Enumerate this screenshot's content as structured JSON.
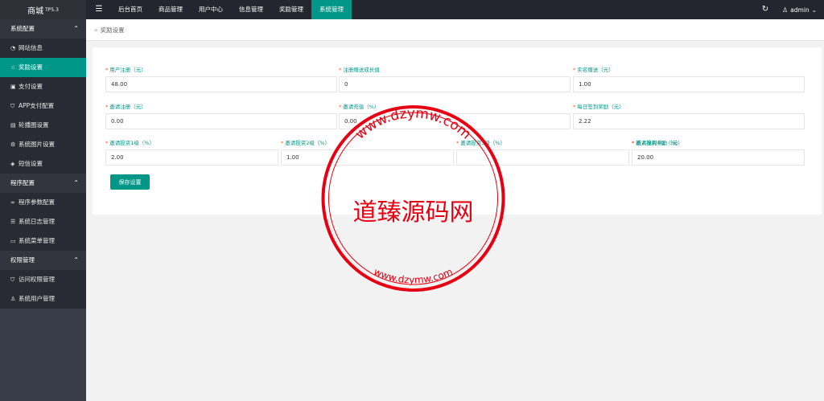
{
  "app": {
    "title": "商城",
    "version": "TP5.3"
  },
  "topnav": {
    "items": [
      {
        "label": "后台首页",
        "active": false
      },
      {
        "label": "商品管理",
        "active": false
      },
      {
        "label": "用户中心",
        "active": false
      },
      {
        "label": "信息管理",
        "active": false
      },
      {
        "label": "奖励管理",
        "active": false
      },
      {
        "label": "系统管理",
        "active": true
      }
    ],
    "user": "admin"
  },
  "sidebar": {
    "groups": [
      {
        "label": "系统配置",
        "items": [
          {
            "label": "网站信息",
            "icon": "dashboard-icon"
          },
          {
            "label": "奖励设置",
            "icon": "star-icon",
            "active": true
          },
          {
            "label": "支付设置",
            "icon": "money-icon"
          },
          {
            "label": "APP支付配置",
            "icon": "shield-icon"
          },
          {
            "label": "轮播图设置",
            "icon": "picture-icon"
          },
          {
            "label": "系统图片设置",
            "icon": "gear-icon"
          },
          {
            "label": "短信设置",
            "icon": "tag-icon"
          }
        ]
      },
      {
        "label": "程序配置",
        "items": [
          {
            "label": "程序参数配置",
            "icon": "link-icon"
          },
          {
            "label": "系统日志管理",
            "icon": "log-icon"
          },
          {
            "label": "系统菜单管理",
            "icon": "menu-icon"
          }
        ]
      },
      {
        "label": "权限管理",
        "items": [
          {
            "label": "访问权限管理",
            "icon": "shield-check-icon"
          },
          {
            "label": "系统用户管理",
            "icon": "user-icon"
          }
        ]
      }
    ]
  },
  "breadcrumb": {
    "label": "奖励设置"
  },
  "form": {
    "fields": [
      {
        "label": "用户注册（元）",
        "value": "48.00",
        "required": true
      },
      {
        "label": "注册赠送成长值",
        "value": "0",
        "required": true
      },
      {
        "label": "实名赠送（元）",
        "value": "1.00",
        "required": true
      },
      {
        "label": "邀请注册（元）",
        "value": "0.00",
        "required": true
      },
      {
        "label": "邀请充值（%）",
        "value": "0.00",
        "required": true
      },
      {
        "label": "每日签到奖励（元）",
        "value": "2.22",
        "required": true
      },
      {
        "label": "邀请投资1级（%）",
        "value": "2.00",
        "required": true
      },
      {
        "label": "邀请投资2级（%）",
        "value": "1.00",
        "required": true
      },
      {
        "label": "邀请投资3级（%）",
        "value": "",
        "required": true
      },
      {
        "label": "邀请投资4级（%）",
        "value": "0.00",
        "required": true
      },
      {
        "label": "新人福利奖励（元）",
        "value": "20.00",
        "required": true
      }
    ],
    "save_label": "保存设置"
  },
  "watermark": {
    "name": "道臻源码网",
    "url_top": "www.dzymw.com",
    "url_bottom": "www.dzymw.com",
    "color": "#e60012"
  }
}
